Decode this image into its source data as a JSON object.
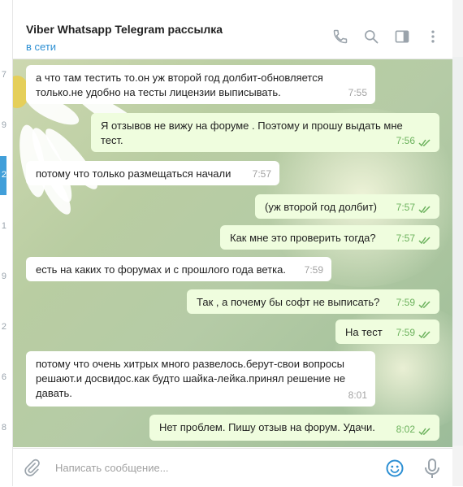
{
  "sidebar_numbers": [
    "7",
    "9",
    "2",
    "1",
    "9",
    "2",
    "6",
    "8"
  ],
  "chat": {
    "title": "Viber Whatsapp Telegram рассылка",
    "status": "в сети"
  },
  "messages": [
    {
      "dir": "in",
      "text": "а что там тестить то.он уж второй год долбит-обновляется\nтолько.не удобно на тесты лицензии выписывать.",
      "time": "7:55"
    },
    {
      "dir": "out",
      "text": "Я отзывов не вижу на форуме . Поэтому и прошу выдать мне\nтест.",
      "time": "7:56"
    },
    {
      "dir": "in",
      "text": "потому что только размещаться начали",
      "time": "7:57"
    },
    {
      "dir": "out",
      "text": "(уж второй год долбит)",
      "time": "7:57"
    },
    {
      "dir": "out",
      "text": "Как мне это проверить тогда?",
      "time": "7:57"
    },
    {
      "dir": "in",
      "text": "есть на каких то форумах и с прошлого года ветка.",
      "time": "7:59"
    },
    {
      "dir": "out",
      "text": "Так , а почему бы софт не выписать?",
      "time": "7:59"
    },
    {
      "dir": "out",
      "text": "На тест",
      "time": "7:59"
    },
    {
      "dir": "in",
      "text": "потому что очень хитрых много развелось.берут-свои вопросы\nрешают.и досвидос.как будто шайка-лейка.принял решение не\nдавать.",
      "time": "8:01"
    },
    {
      "dir": "out",
      "text": "Нет проблем. Пишу отзыв на форум. Удачи.",
      "time": "8:02"
    }
  ],
  "input": {
    "placeholder": "Написать сообщение..."
  },
  "icons": {
    "header": [
      "phone-icon",
      "search-icon",
      "sidebar-toggle-icon",
      "more-vertical-icon"
    ],
    "input": [
      "attach-icon",
      "emoji-icon",
      "microphone-icon"
    ],
    "read_receipt": "double-check-icon"
  },
  "colors": {
    "accent": "#419fd9",
    "status": "#2c8fd3",
    "outgoing_bubble": "#effdde",
    "incoming_bubble": "#ffffff",
    "read_check": "#6cb25d"
  }
}
